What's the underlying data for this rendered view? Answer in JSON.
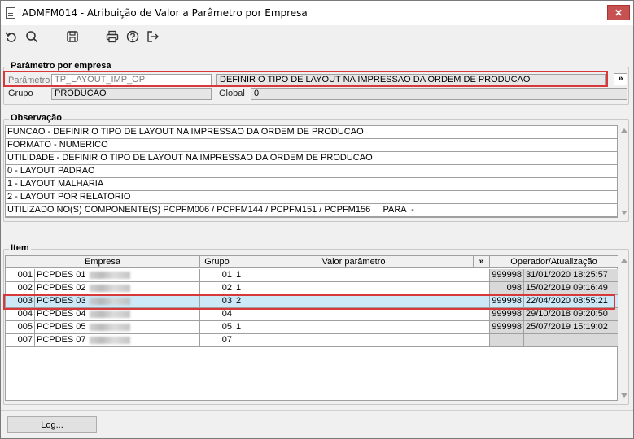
{
  "window": {
    "title": "ADMFM014 - Atribuição de Valor a Parâmetro por Empresa",
    "close_glyph": "✕"
  },
  "toolbar": {
    "icons": [
      "undo-icon",
      "search-icon",
      "save-icon",
      "print-icon",
      "help-icon",
      "exit-icon"
    ]
  },
  "param_group": {
    "legend": "Parâmetro por empresa",
    "parametro_label": "Parâmetro",
    "parametro_value": "TP_LAYOUT_IMP_OP",
    "descricao_value": "DEFINIR O TIPO DE LAYOUT NA IMPRESSAO DA ORDEM DE PRODUCAO",
    "more_button": "»",
    "grupo_label": "Grupo",
    "grupo_value": "PRODUCAO",
    "global_label": "Global",
    "global_value": "0"
  },
  "observacao": {
    "legend": "Observação",
    "lines": [
      "FUNCAO - DEFINIR O TIPO DE LAYOUT NA IMPRESSAO DA ORDEM DE PRODUCAO",
      "FORMATO - NUMERICO",
      "UTILIDADE - DEFINIR O TIPO DE LAYOUT NA IMPRESSAO DA ORDEM DE PRODUCAO",
      "0 - LAYOUT PADRAO",
      "1 - LAYOUT MALHARIA",
      "2 - LAYOUT POR RELATORIO",
      "UTILIZADO NO(S) COMPONENTE(S) PCPFM006 / PCPFM144 / PCPFM151 / PCPFM156     PARA  -"
    ]
  },
  "item": {
    "legend": "Item",
    "headers": {
      "empresa": "Empresa",
      "grupo": "Grupo",
      "valor": "Valor parâmetro",
      "more": "»",
      "operador": "Operador/Atualização"
    },
    "rows": [
      {
        "num": "001",
        "empresa": "PCPDES 01",
        "grupo": "01",
        "valor": "1",
        "operador": "999998",
        "data": "31/01/2020 18:25:57"
      },
      {
        "num": "002",
        "empresa": "PCPDES 02",
        "grupo": "02",
        "valor": "1",
        "operador": "098",
        "data": "15/02/2019 09:16:49"
      },
      {
        "num": "003",
        "empresa": "PCPDES 03",
        "grupo": "03",
        "valor": "2",
        "operador": "999998",
        "data": "22/04/2020 08:55:21"
      },
      {
        "num": "004",
        "empresa": "PCPDES 04",
        "grupo": "04",
        "valor": "",
        "operador": "999998",
        "data": "29/10/2018 09:20:50"
      },
      {
        "num": "005",
        "empresa": "PCPDES 05",
        "grupo": "05",
        "valor": "1",
        "operador": "999998",
        "data": "25/07/2019 15:19:02"
      },
      {
        "num": "007",
        "empresa": "PCPDES 07",
        "grupo": "07",
        "valor": "",
        "operador": "",
        "data": ""
      }
    ],
    "selected_row": 2
  },
  "footer": {
    "log_button": "Log..."
  },
  "colors": {
    "highlight_border": "#d9383a",
    "selected_row_bg": "#cde8f7",
    "close_button": "#c75050"
  }
}
